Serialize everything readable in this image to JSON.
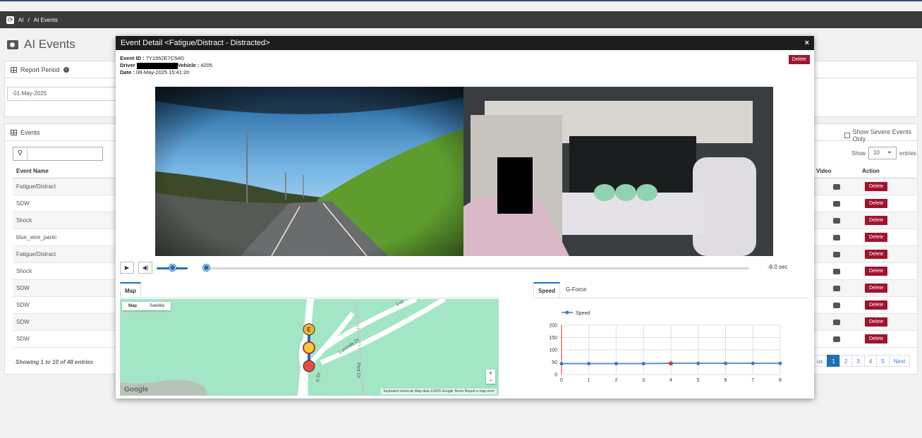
{
  "breadcrumb": {
    "root": "AI",
    "sep": "/",
    "current": "AI Events"
  },
  "page": {
    "title": "AI Events"
  },
  "report_period": {
    "label": "Report Period",
    "date": "01-May-2025"
  },
  "events": {
    "label": "Events",
    "severe_label": "Show Severe Events Only",
    "show_label": "Show",
    "entries_value": "10",
    "entries_label": "entries",
    "col_event_name": "Event Name",
    "col_video": "Video",
    "col_action": "Action",
    "rows": [
      "Fatigue/Distract",
      "SDW",
      "Shock",
      "blue_wire_panic",
      "Fatigue/Distract",
      "Shock",
      "SDW",
      "SDW",
      "SDW",
      "SDW"
    ],
    "delete_label": "Delete",
    "showing": "Showing 1 to 10 of 48 entries",
    "pager": [
      "us",
      "1",
      "2",
      "3",
      "4",
      "5",
      "Next"
    ]
  },
  "modal": {
    "title": "Event Detail <Fatigue/Distract - Distracted>",
    "close": "×",
    "delete_label": "Delete",
    "event_id_label": "Event ID :",
    "event_id": "7Y1952E7C54D",
    "driver_label": "Driver",
    "vehicle_label": "Vehicle :",
    "vehicle": "4205",
    "date_label": "Date :",
    "date": "08-May-2025 15:41:20",
    "time_display": "-8.0 sec",
    "volume": 0.5,
    "progress": 0.0,
    "map_tab": "Map",
    "map_types": [
      "Map",
      "Satellite"
    ],
    "map_footer": "Keyboard shortcuts   Map data ©2025 Google   Terms   Report a map error",
    "google": "Google",
    "street_1": "Lucinda Dr",
    "street_2": "Port Dr",
    "street_3": "Luc",
    "street_4": "rt Dr",
    "marker_e": "E",
    "speed_tab": "Speed",
    "gforce_tab": "G-Force"
  },
  "chart_data": {
    "type": "line",
    "x": [
      0,
      1,
      2,
      3,
      4,
      5,
      6,
      7,
      8
    ],
    "series": [
      {
        "name": "Speed",
        "values": [
          44,
          44,
          44,
          44,
          45,
          45,
          45,
          45,
          45
        ],
        "color": "#3d78c9"
      }
    ],
    "event_marker": {
      "x": 4,
      "marker": "star",
      "color": "#c0392b"
    },
    "xlim": [
      0,
      8
    ],
    "ylim": [
      0,
      200
    ],
    "yticks": [
      0,
      50,
      100,
      150,
      200
    ],
    "grid": true,
    "legend": "top-left"
  }
}
